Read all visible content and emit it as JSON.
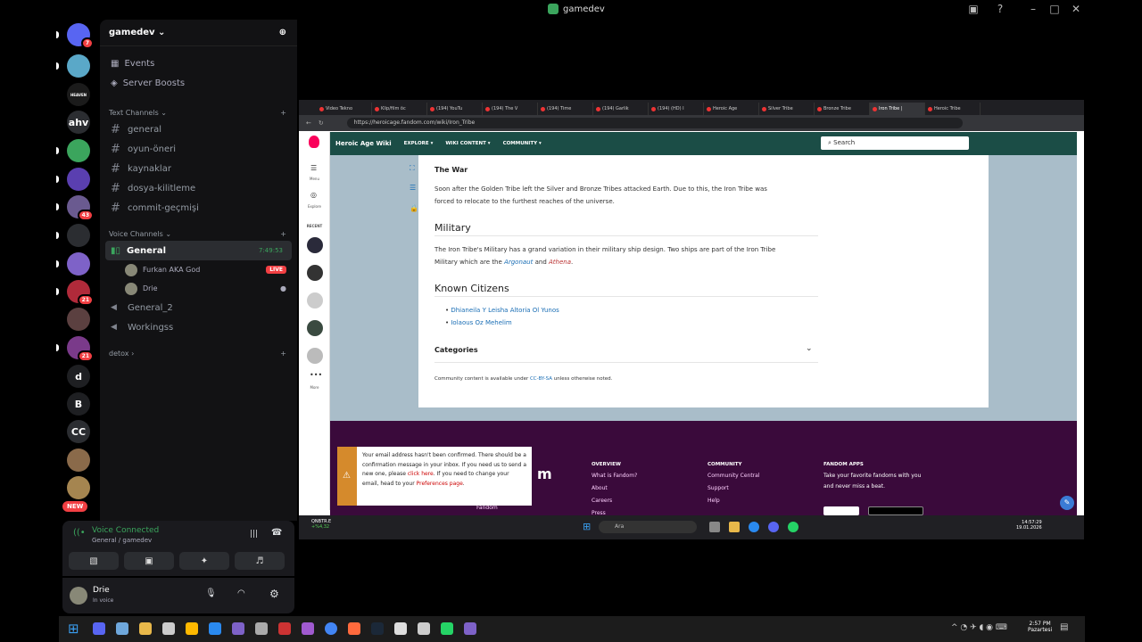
{
  "window": {
    "title": "gamedev"
  },
  "servers": {
    "items": [
      {
        "label": "",
        "color": "#5865f2",
        "badge": "7"
      },
      {
        "label": "",
        "color": "#5aa8c8",
        "badge": ""
      },
      {
        "label": "HEAVEN",
        "color": "#1b1b1b",
        "badge": ""
      },
      {
        "label": "ahv",
        "color": "#2b2d31",
        "badge": ""
      },
      {
        "label": "",
        "color": "#3ba55d",
        "badge": ""
      },
      {
        "label": "",
        "color": "#5a3fb0",
        "badge": ""
      },
      {
        "label": "",
        "color": "#6a5a90",
        "badge": "43"
      },
      {
        "label": "",
        "color": "#2b2d31",
        "badge": ""
      },
      {
        "label": "",
        "color": "#7e62c8",
        "badge": ""
      },
      {
        "label": "",
        "color": "#b02a3a",
        "badge": "21"
      },
      {
        "label": "",
        "color": "#5b4040",
        "badge": ""
      },
      {
        "label": "",
        "color": "#7a3a8a",
        "badge": "21"
      },
      {
        "label": "d",
        "color": "#1e1f22",
        "badge": ""
      },
      {
        "label": "B",
        "color": "#1e1f22",
        "badge": ""
      },
      {
        "label": "CC",
        "color": "#2b2d31",
        "badge": ""
      },
      {
        "label": "",
        "color": "#8a6a4a",
        "badge": ""
      },
      {
        "label": "",
        "color": "#a58550",
        "badge": ""
      }
    ],
    "new_badge": "NEW"
  },
  "channel_panel": {
    "server_name": "gamedev",
    "events": "Events",
    "boosts": "Server Boosts",
    "text_category": "Text Channels",
    "text_channels": [
      "general",
      "oyun-öneri",
      "kaynaklar",
      "dosya-kilitleme",
      "commit-geçmişi"
    ],
    "voice_category": "Voice Channels",
    "voice_active": {
      "name": "General",
      "time": "7:49:53"
    },
    "voice_users": [
      {
        "name": "Furkan AKA God",
        "live": "LIVE"
      },
      {
        "name": "Drie",
        "live": ""
      }
    ],
    "voice_others": [
      "General_2",
      "Workingss"
    ],
    "other_category": "detox"
  },
  "voice_connected": {
    "title": "Voice Connected",
    "subtitle": "General / gamedev"
  },
  "user": {
    "name": "Drie",
    "status": "In voice"
  },
  "browser": {
    "tabs": [
      "Video Tekno",
      "Klip/film öc",
      "(194) YouTu",
      "(194) The V",
      "(194) Time",
      "(194) Garlik",
      "(194) (HD) I",
      "Heroic Age",
      "Silver Tribe",
      "Bronze Tribe",
      "Iron Tribe |",
      "Heroic Tribe"
    ],
    "url": "https://heroicage.fandom.com/wiki/Iron_Tribe",
    "wiki_title": "Heroic Age Wiki",
    "nav": [
      "EXPLORE",
      "WIKI CONTENT",
      "COMMUNITY"
    ],
    "search": "Search",
    "rail": {
      "menu": "Menu",
      "explore": "Explore",
      "recent": "RECENT",
      "more": "More"
    }
  },
  "article": {
    "war_heading": "The War",
    "war_text_1": "Soon after the Golden Tribe left the Silver and Bronze Tribes attacked Earth. Due to this, the Iron Tribe was",
    "war_text_2": "forced to relocate to the furthest reaches of the universe.",
    "military_heading": "Military",
    "military_text_1": "The Iron Tribe's Military has a grand variation in their military ship design. Two ships are part of the Iron Tribe",
    "military_text_2a": "Military which are the",
    "military_link1": "Argonaut",
    "military_and": "and",
    "military_link2": "Athena",
    "citizens_heading": "Known Citizens",
    "citizens": [
      "Dhianeila Y Leisha Altoria Ol Yunos",
      "Iolaous Oz Mehelim"
    ],
    "categories": "Categories",
    "license_pre": "Community content is available under",
    "license_link": "CC-BY-SA",
    "license_post": "unless otherwise noted."
  },
  "footer": {
    "overview": "OVERVIEW",
    "overview_links": [
      "What is Fandom?",
      "About",
      "Careers",
      "Press"
    ],
    "community": "COMMUNITY",
    "community_links": [
      "Community Central",
      "Support",
      "Help"
    ],
    "apps": "FANDOM APPS",
    "apps_text": "Take your favorite fandoms with you and never miss a beat.",
    "fandom": "Fandom"
  },
  "notice": {
    "text_1": "Your email address hasn't been confirmed. There should be a confirmation message in your inbox. If you need us to send a new one, please",
    "link_1": "click here",
    "text_2": ". If you need to change your email, head to your",
    "link_2": "Preferences page",
    "text_3": "."
  },
  "inner_taskbar": {
    "stock": "QNBTR.E",
    "stock_change": "+%4,32",
    "search": "Ara",
    "time": "14:57:29",
    "date": "19.01.2026"
  },
  "taskbar": {
    "time": "2:57 PM",
    "day": "Pazartesi"
  }
}
